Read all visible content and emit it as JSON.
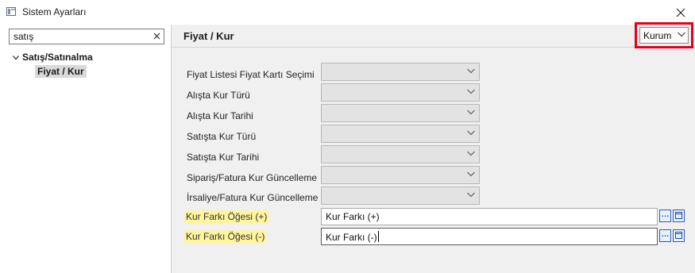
{
  "window": {
    "title": "Sistem Ayarları"
  },
  "search": {
    "value": "satış"
  },
  "tree": {
    "root_label": "Satış/Satınalma",
    "leaf_label": "Fiyat / Kur"
  },
  "section": {
    "title": "Fiyat / Kur",
    "scope_value": "Kurum"
  },
  "settings": [
    {
      "label": "Fiyat Listesi Fiyat Kartı Seçimi",
      "value": ""
    },
    {
      "label": "Alışta Kur Türü",
      "value": ""
    },
    {
      "label": "Alışta Kur Tarihi",
      "value": ""
    },
    {
      "label": "Satışta Kur Türü",
      "value": ""
    },
    {
      "label": "Satışta Kur Tarihi",
      "value": ""
    },
    {
      "label": "Sipariş/Fatura Kur Güncelleme",
      "value": ""
    },
    {
      "label": "İrsaliye/Fatura Kur Güncelleme",
      "value": ""
    }
  ],
  "lookups": [
    {
      "label": "Kur Farkı Öğesi (+)",
      "value": "Kur Farkı (+)"
    },
    {
      "label": "Kur Farkı Öğesi (-)",
      "value": "Kur Farkı (-)"
    }
  ],
  "colors": {
    "highlight_border": "#e3001b",
    "label_highlight": "#fff59d",
    "lookup_button": "#2a5fb8"
  }
}
